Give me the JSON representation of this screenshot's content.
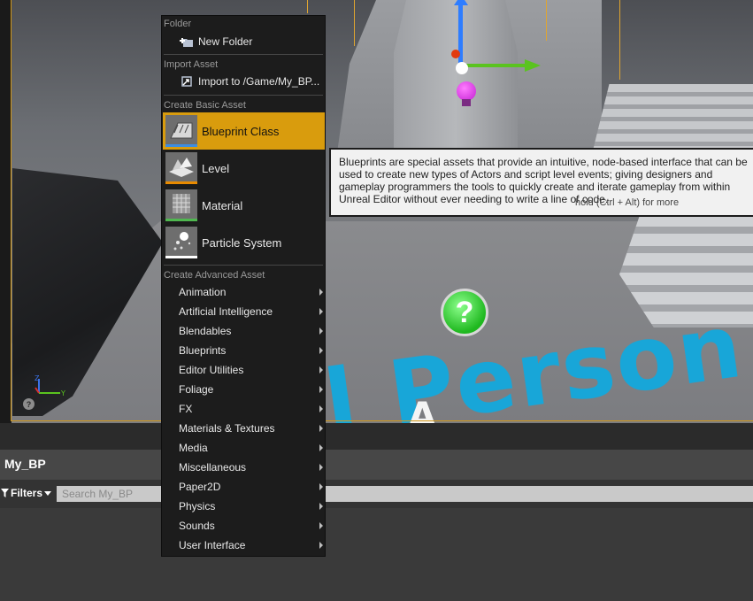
{
  "viewport": {
    "overlay_text": "l Person",
    "overlay_letter": "A",
    "help_symbol": "?",
    "axis_labels": {
      "z": "Z",
      "y": "Y"
    },
    "axis_button": "?"
  },
  "menu": {
    "folder": {
      "header": "Folder",
      "new_folder": {
        "label": "New Folder",
        "icon": "new-folder-icon"
      }
    },
    "import": {
      "header": "Import Asset",
      "import_item": {
        "label": "Import to /Game/My_BP...",
        "icon": "import-icon"
      }
    },
    "basic": {
      "header": "Create Basic Asset",
      "items": [
        {
          "label": "Blueprint Class",
          "icon": "blueprint-class-icon",
          "color": "#3d8de0",
          "active": true
        },
        {
          "label": "Level",
          "icon": "level-icon",
          "color": "#e88a00"
        },
        {
          "label": "Material",
          "icon": "material-icon",
          "color": "#4fb84f"
        },
        {
          "label": "Particle System",
          "icon": "particle-system-icon",
          "color": "#ffffff"
        }
      ]
    },
    "advanced": {
      "header": "Create Advanced Asset",
      "items": [
        {
          "label": "Animation"
        },
        {
          "label": "Artificial Intelligence"
        },
        {
          "label": "Blendables"
        },
        {
          "label": "Blueprints"
        },
        {
          "label": "Editor Utilities"
        },
        {
          "label": "Foliage"
        },
        {
          "label": "FX"
        },
        {
          "label": "Materials & Textures"
        },
        {
          "label": "Media"
        },
        {
          "label": "Miscellaneous"
        },
        {
          "label": "Paper2D"
        },
        {
          "label": "Physics"
        },
        {
          "label": "Sounds"
        },
        {
          "label": "User Interface"
        }
      ]
    }
  },
  "tooltip": {
    "description": "Blueprints are special assets that provide an intuitive, node-based interface that can be used to create new types of Actors and script level events; giving designers and gameplay programmers the tools to quickly create and iterate gameplay from within Unreal Editor without ever needing to write a line of code.",
    "hint": "hold (Ctrl + Alt) for more"
  },
  "content_browser": {
    "title": "My_BP",
    "filters_label": "Filters",
    "search_placeholder": "Search My_BP"
  },
  "colors": {
    "accent": "#d99c0d",
    "menu_bg": "#1c1c1c",
    "tooltip_bg": "#f1f1f1"
  }
}
